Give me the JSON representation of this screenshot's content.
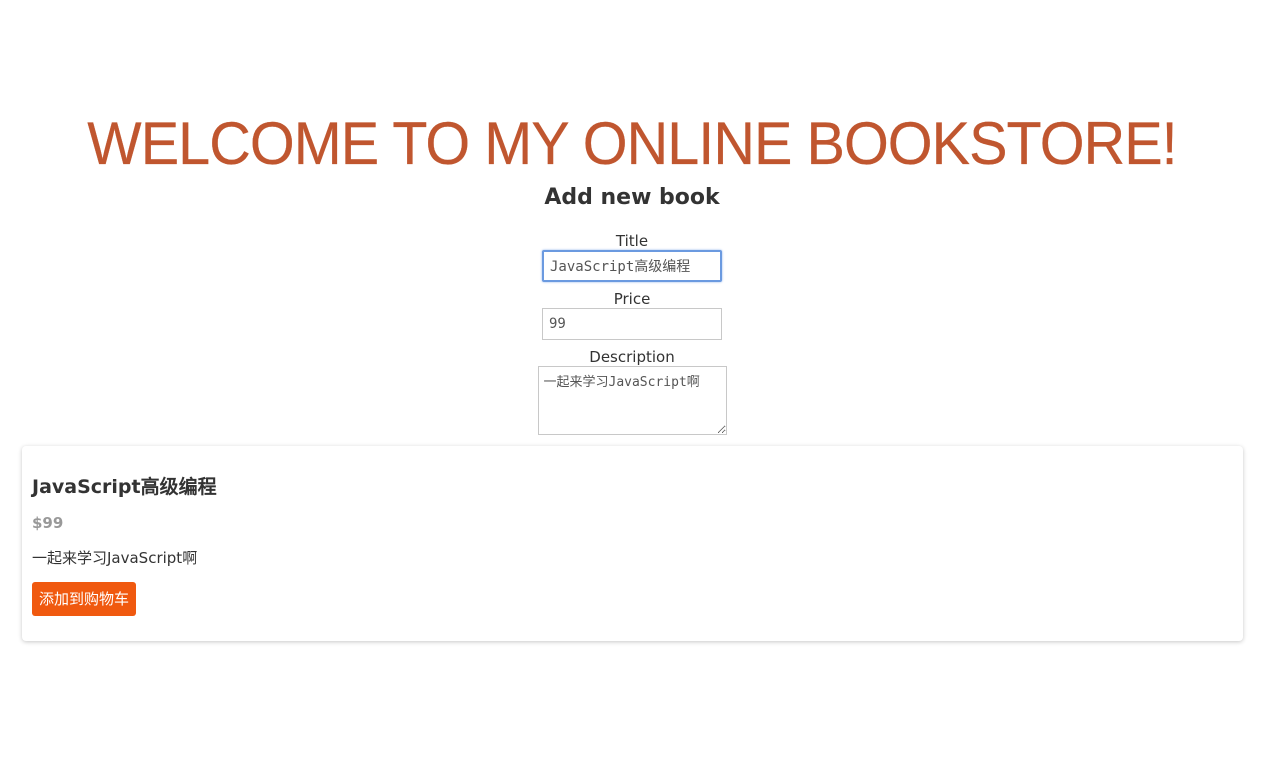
{
  "header": {
    "banner": "WELCOME TO MY ONLINE BOOKSTORE!"
  },
  "form": {
    "heading": "Add new book",
    "title_label": "Title",
    "title_value": "JavaScript高级编程",
    "price_label": "Price",
    "price_value": "99",
    "description_label": "Description",
    "description_value": "一起来学习JavaScript啊"
  },
  "book": {
    "title": "JavaScript高级编程",
    "price": "$99",
    "description": "一起来学习JavaScript啊",
    "add_to_cart_label": "添加到购物车"
  },
  "colors": {
    "banner": "#c0562f",
    "button": "#f0590f",
    "price": "#999999",
    "focus_border": "#6b9ae0"
  }
}
